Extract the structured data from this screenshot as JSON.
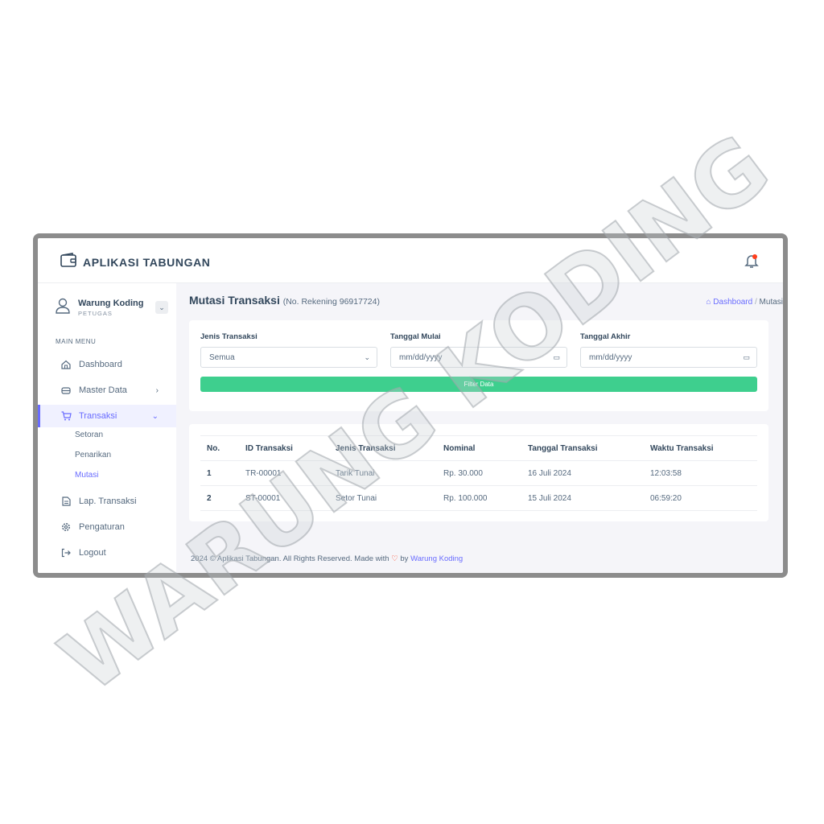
{
  "app": {
    "title": "APLIKASI TABUNGAN"
  },
  "user": {
    "name": "Warung Koding",
    "role": "PETUGAS"
  },
  "sidebar": {
    "section_title": "MAIN MENU",
    "items": [
      {
        "label": "Dashboard",
        "icon": "home-icon"
      },
      {
        "label": "Master Data",
        "icon": "database-icon"
      },
      {
        "label": "Transaksi",
        "icon": "cart-icon"
      },
      {
        "label": "Lap. Transaksi",
        "icon": "report-icon"
      },
      {
        "label": "Pengaturan",
        "icon": "gear-icon"
      },
      {
        "label": "Logout",
        "icon": "logout-icon"
      }
    ],
    "transaksi_sub": [
      "Setoran",
      "Penarikan",
      "Mutasi"
    ]
  },
  "page": {
    "title": "Mutasi Transaksi",
    "subtitle": "(No. Rekening 96917724)",
    "breadcrumb": {
      "home": "Dashboard",
      "separator": "/",
      "current": "Mutasi"
    }
  },
  "filter": {
    "jenis_label": "Jenis Transaksi",
    "jenis_value": "Semua",
    "mulai_label": "Tanggal Mulai",
    "mulai_placeholder": "mm/dd/yyyy",
    "akhir_label": "Tanggal Akhir",
    "akhir_placeholder": "mm/dd/yyyy",
    "button_label": "Filter Data"
  },
  "table": {
    "headers": [
      "No.",
      "ID Transaksi",
      "Jenis Transaksi",
      "Nominal",
      "Tanggal Transaksi",
      "Waktu Transaksi"
    ],
    "rows": [
      [
        "1",
        "TR-00001",
        "Tarik Tunai",
        "Rp. 30.000",
        "16 Juli 2024",
        "12:03:58"
      ],
      [
        "2",
        "ST-00001",
        "Setor Tunai",
        "Rp. 100.000",
        "15 Juli 2024",
        "06:59:20"
      ]
    ]
  },
  "footer": {
    "prefix": "2024 © Aplikasi Tabungan. All Rights Reserved. Made with",
    "by": "by",
    "author": "Warung Koding"
  },
  "watermark": {
    "text": "WARUNG KODING"
  },
  "colors": {
    "primary": "#696cff",
    "success": "#3ecf8e",
    "danger": "#ff3e1d"
  }
}
